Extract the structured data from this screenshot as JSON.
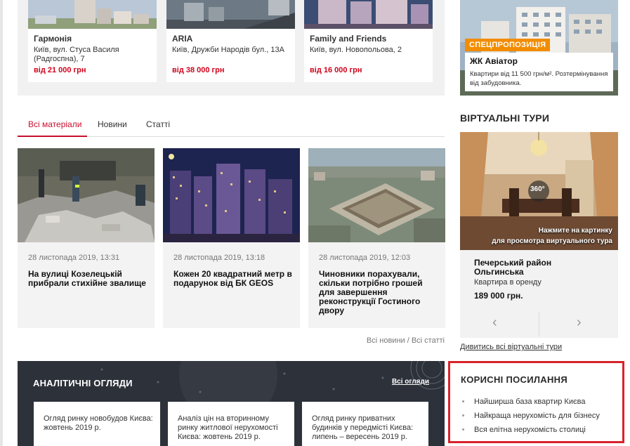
{
  "properties": [
    {
      "name": "Гармонія",
      "address": "Київ, вул. Стуса Василя (Радгоспна), 7",
      "price": "від 21 000 грн"
    },
    {
      "name": "ARIA",
      "address": "Київ, Дружби Народів бул., 13А",
      "price": "від 38 000 грн"
    },
    {
      "name": "Family and Friends",
      "address": "Київ, вул. Новопольова, 2",
      "price": "від 16 000 грн"
    }
  ],
  "tabs": [
    {
      "label": "Всі матеріали",
      "active": true
    },
    {
      "label": "Новини",
      "active": false
    },
    {
      "label": "Статті",
      "active": false
    }
  ],
  "news": [
    {
      "date": "28 листопада 2019, 13:31",
      "title": "На вулиці Козелецькій прибрали стихійне звалище"
    },
    {
      "date": "28 листопада 2019, 13:18",
      "title": "Кожен 20 квадратний метр в подарунок від БК GEOS"
    },
    {
      "date": "28 листопада 2019, 12:03",
      "title": "Чиновники порахували, скільки потрібно грошей для завершення реконструкції Гостиного двору"
    }
  ],
  "all_news": {
    "news_label": "Всі новини",
    "separator": " / ",
    "articles_label": "Всі статті"
  },
  "analytics": {
    "title": "АНАЛІТИЧНІ ОГЛЯДИ",
    "all_label": "Всі огляди",
    "items": [
      "Огляд ринку новобудов Києва: жовтень 2019 р.",
      "Аналіз цін на вторинному ринку житлової нерухомості Києва: жовтень 2019 р.",
      "Огляд ринку приватних будинків у передмісті Києва: липень – вересень 2019 р."
    ]
  },
  "promo": {
    "badge": "СПЕЦПРОПОЗИЦІЯ",
    "name": "ЖК Авіатор",
    "description": "Квартири від 11 500 грн/м². Розтермінування від забудовника."
  },
  "virtual_tours": {
    "title": "ВІРТУАЛЬНІ ТУРИ",
    "badge_360": "360°",
    "caption_line1": "Нажмите на картинку",
    "caption_line2": "для просмотра виртуального тура",
    "name": "Печерський район Ольгинська",
    "type": "Квартира в оренду",
    "price": "189 000 грн.",
    "prev_icon": "‹",
    "next_icon": "›",
    "all_label": "Дивитись всі віртуальні тури"
  },
  "useful_links": {
    "title": "КОРИСНІ ПОСИЛАННЯ",
    "items": [
      "Найширша база квартир Києва",
      "Найкраща нерухомість для бізнесу",
      "Вся елітна нерухомість столиці"
    ]
  }
}
